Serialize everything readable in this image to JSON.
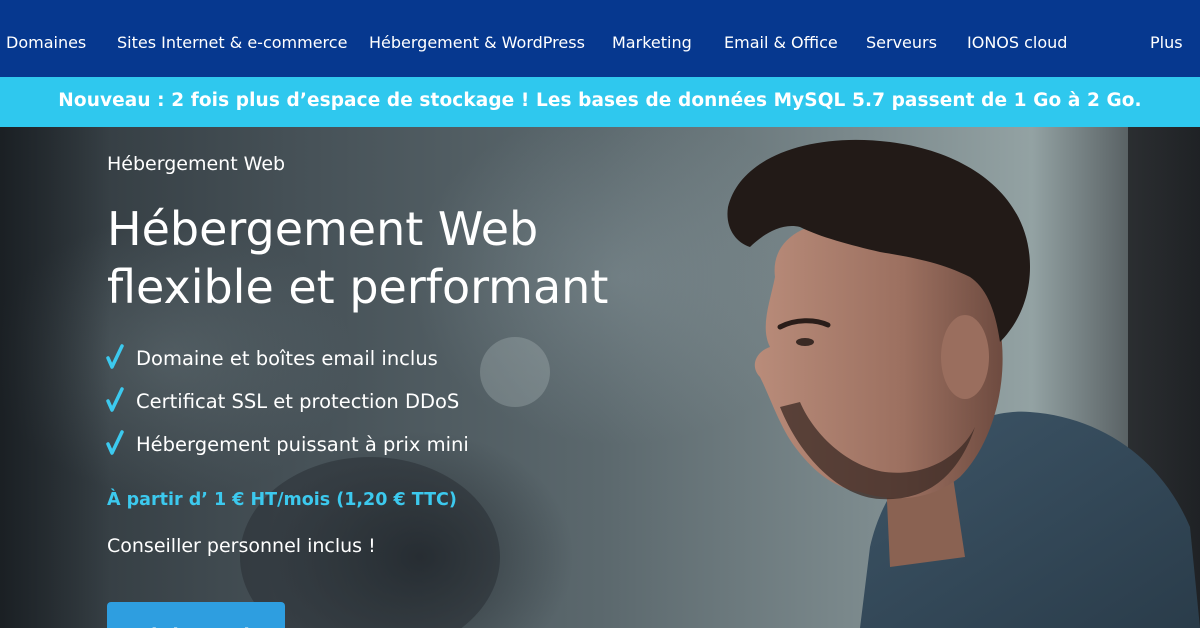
{
  "nav": {
    "items": [
      {
        "label": "Domaines"
      },
      {
        "label": "Sites Internet & e-commerce"
      },
      {
        "label": "Hébergement & WordPress"
      },
      {
        "label": "Marketing"
      },
      {
        "label": "Email & Office"
      },
      {
        "label": "Serveurs"
      },
      {
        "label": "IONOS cloud"
      },
      {
        "label": "Plus"
      }
    ]
  },
  "announcement": {
    "text": "Nouveau : 2 fois plus d’espace de stockage ! Les bases de données MySQL 5.7 passent de 1 Go à 2 Go."
  },
  "hero": {
    "eyebrow": "Hébergement Web",
    "headline_line1": "Hébergement Web",
    "headline_line2": "flexible et performant",
    "features": [
      {
        "text": "Domaine et boîtes email inclus",
        "icon": "checkmark-icon"
      },
      {
        "text": "Certificat SSL et protection DDoS",
        "icon": "checkmark-icon"
      },
      {
        "text": "Hébergement puissant à prix mini",
        "icon": "checkmark-icon"
      }
    ],
    "price": "À partir d’ 1 € HT/mois (1,20 € TTC)",
    "advisor": "Conseiller personnel inclus !",
    "cta_label": "Voir les packs"
  },
  "colors": {
    "nav_bg": "#06388f",
    "announce_bg": "#2fc8ee",
    "accent": "#3cc9ee",
    "cta_bg": "#2e9ee0"
  }
}
